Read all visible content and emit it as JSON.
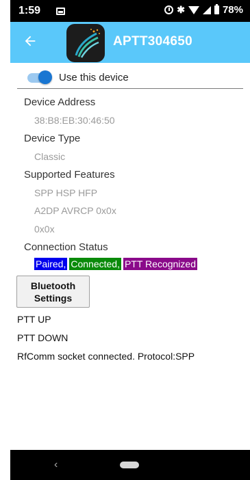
{
  "status_bar": {
    "time": "1:59",
    "battery": "78%"
  },
  "app_bar": {
    "title": "APTT304650"
  },
  "toggle": {
    "label": "Use this device",
    "on": true
  },
  "fields": {
    "device_address_label": "Device Address",
    "device_address_value": "38:B8:EB:30:46:50",
    "device_type_label": "Device Type",
    "device_type_value": "Classic",
    "supported_features_label": "Supported Features",
    "supported_features_line1": "SPP HSP HFP",
    "supported_features_line2": "A2DP AVRCP 0x0x",
    "supported_features_line3": "0x0x",
    "connection_status_label": "Connection Status"
  },
  "status_chips": {
    "paired": "Paired,",
    "connected": "Connected,",
    "ptt": "PTT Recognized"
  },
  "bluetooth_button": {
    "line1": "Bluetooth",
    "line2": "Settings"
  },
  "log": {
    "line1": "PTT UP",
    "line2": "PTT DOWN",
    "line3": "RfComm socket connected. Protocol:SPP"
  },
  "colors": {
    "app_bar": "#5ac8fa",
    "toggle_accent": "#1976d2",
    "paired": "#0000ee",
    "connected": "#0a8a0a",
    "ptt": "#8a0a8a"
  }
}
